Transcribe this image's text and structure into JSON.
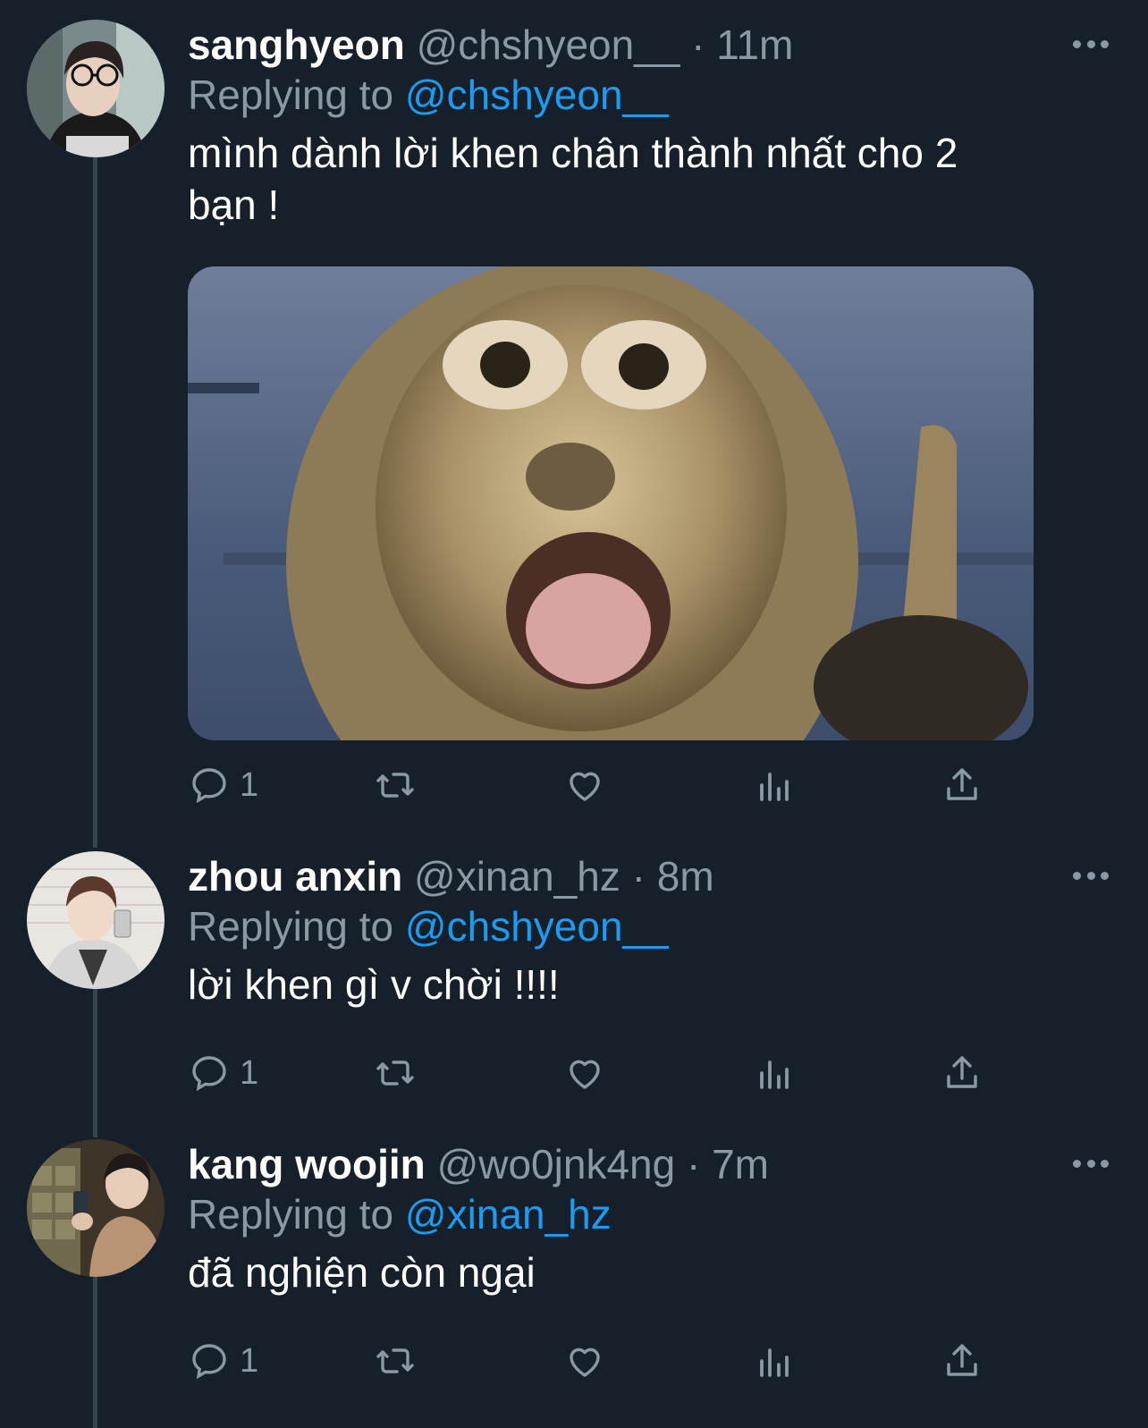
{
  "colors": {
    "background": "#15202b",
    "text": "#ffffff",
    "muted": "#8b98a5",
    "mention": "#1d9bf0",
    "thread_line": "#38444d"
  },
  "tweets": [
    {
      "display_name": "sanghyeon",
      "handle": "@chshyeon__",
      "separator": "·",
      "time": "11m",
      "replying_prefix": "Replying to",
      "replying_to": "@chshyeon__",
      "text": "mình dành lời khen chân thành nhất cho 2 bạn !",
      "has_media": true,
      "reply_count": "1",
      "icons": [
        "reply-icon",
        "retweet-icon",
        "like-icon",
        "analytics-icon",
        "share-icon",
        "more-icon"
      ]
    },
    {
      "display_name": "zhou anxin",
      "handle": "@xinan_hz",
      "separator": "·",
      "time": "8m",
      "replying_prefix": "Replying to",
      "replying_to": "@chshyeon__",
      "text": "lời khen gì v chời !!!!",
      "has_media": false,
      "reply_count": "1",
      "icons": [
        "reply-icon",
        "retweet-icon",
        "like-icon",
        "analytics-icon",
        "share-icon",
        "more-icon"
      ]
    },
    {
      "display_name": "kang woojin",
      "handle": "@wo0jnk4ng",
      "separator": "·",
      "time": "7m",
      "replying_prefix": "Replying to",
      "replying_to": "@xinan_hz",
      "text": "đã nghiện còn ngại",
      "has_media": false,
      "reply_count": "1",
      "icons": [
        "reply-icon",
        "retweet-icon",
        "like-icon",
        "analytics-icon",
        "share-icon",
        "more-icon"
      ]
    }
  ]
}
